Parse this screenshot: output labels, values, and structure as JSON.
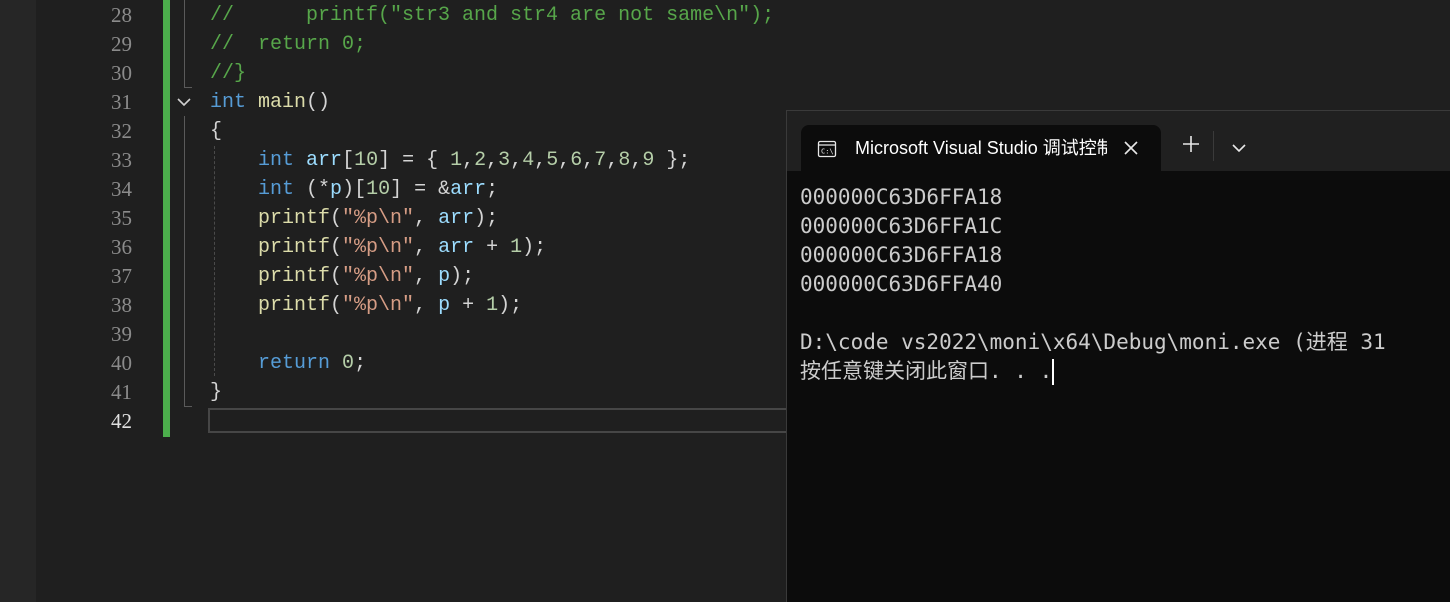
{
  "editor": {
    "line_numbers": [
      "28",
      "29",
      "30",
      "31",
      "32",
      "33",
      "34",
      "35",
      "36",
      "37",
      "38",
      "39",
      "40",
      "41",
      "42"
    ],
    "active_line": "42",
    "lines": [
      [
        {
          "t": "//      printf(\"str3 and str4 are not same\\n\");",
          "c": "cm"
        }
      ],
      [
        {
          "t": "//  return 0;",
          "c": "cm"
        }
      ],
      [
        {
          "t": "//}",
          "c": "cm"
        }
      ],
      [
        {
          "t": "int",
          "c": "kw"
        },
        {
          "t": " ",
          "c": "pl"
        },
        {
          "t": "main",
          "c": "fn"
        },
        {
          "t": "()",
          "c": "pl"
        }
      ],
      [
        {
          "t": "{",
          "c": "pl"
        }
      ],
      [
        {
          "t": "    ",
          "c": "pl"
        },
        {
          "t": "int",
          "c": "kw"
        },
        {
          "t": " ",
          "c": "pl"
        },
        {
          "t": "arr",
          "c": "id"
        },
        {
          "t": "[",
          "c": "pl"
        },
        {
          "t": "10",
          "c": "nm"
        },
        {
          "t": "] = { ",
          "c": "pl"
        },
        {
          "t": "1",
          "c": "nm"
        },
        {
          "t": ",",
          "c": "pl"
        },
        {
          "t": "2",
          "c": "nm"
        },
        {
          "t": ",",
          "c": "pl"
        },
        {
          "t": "3",
          "c": "nm"
        },
        {
          "t": ",",
          "c": "pl"
        },
        {
          "t": "4",
          "c": "nm"
        },
        {
          "t": ",",
          "c": "pl"
        },
        {
          "t": "5",
          "c": "nm"
        },
        {
          "t": ",",
          "c": "pl"
        },
        {
          "t": "6",
          "c": "nm"
        },
        {
          "t": ",",
          "c": "pl"
        },
        {
          "t": "7",
          "c": "nm"
        },
        {
          "t": ",",
          "c": "pl"
        },
        {
          "t": "8",
          "c": "nm"
        },
        {
          "t": ",",
          "c": "pl"
        },
        {
          "t": "9",
          "c": "nm"
        },
        {
          "t": " };",
          "c": "pl"
        }
      ],
      [
        {
          "t": "    ",
          "c": "pl"
        },
        {
          "t": "int",
          "c": "kw"
        },
        {
          "t": " (*",
          "c": "pl"
        },
        {
          "t": "p",
          "c": "id"
        },
        {
          "t": ")[",
          "c": "pl"
        },
        {
          "t": "10",
          "c": "nm"
        },
        {
          "t": "] = &",
          "c": "pl"
        },
        {
          "t": "arr",
          "c": "id"
        },
        {
          "t": ";",
          "c": "pl"
        }
      ],
      [
        {
          "t": "    ",
          "c": "pl"
        },
        {
          "t": "printf",
          "c": "fn"
        },
        {
          "t": "(",
          "c": "pl"
        },
        {
          "t": "\"%p\\n\"",
          "c": "st"
        },
        {
          "t": ", ",
          "c": "pl"
        },
        {
          "t": "arr",
          "c": "id"
        },
        {
          "t": ");",
          "c": "pl"
        }
      ],
      [
        {
          "t": "    ",
          "c": "pl"
        },
        {
          "t": "printf",
          "c": "fn"
        },
        {
          "t": "(",
          "c": "pl"
        },
        {
          "t": "\"%p\\n\"",
          "c": "st"
        },
        {
          "t": ", ",
          "c": "pl"
        },
        {
          "t": "arr",
          "c": "id"
        },
        {
          "t": " + ",
          "c": "pl"
        },
        {
          "t": "1",
          "c": "nm"
        },
        {
          "t": ");",
          "c": "pl"
        }
      ],
      [
        {
          "t": "    ",
          "c": "pl"
        },
        {
          "t": "printf",
          "c": "fn"
        },
        {
          "t": "(",
          "c": "pl"
        },
        {
          "t": "\"%p\\n\"",
          "c": "st"
        },
        {
          "t": ", ",
          "c": "pl"
        },
        {
          "t": "p",
          "c": "id"
        },
        {
          "t": ");",
          "c": "pl"
        }
      ],
      [
        {
          "t": "    ",
          "c": "pl"
        },
        {
          "t": "printf",
          "c": "fn"
        },
        {
          "t": "(",
          "c": "pl"
        },
        {
          "t": "\"%p\\n\"",
          "c": "st"
        },
        {
          "t": ", ",
          "c": "pl"
        },
        {
          "t": "p",
          "c": "id"
        },
        {
          "t": " + ",
          "c": "pl"
        },
        {
          "t": "1",
          "c": "nm"
        },
        {
          "t": ");",
          "c": "pl"
        }
      ],
      [
        {
          "t": "",
          "c": "pl"
        }
      ],
      [
        {
          "t": "    ",
          "c": "pl"
        },
        {
          "t": "return",
          "c": "kw"
        },
        {
          "t": " ",
          "c": "pl"
        },
        {
          "t": "0",
          "c": "nm"
        },
        {
          "t": ";",
          "c": "pl"
        }
      ],
      [
        {
          "t": "}",
          "c": "pl"
        }
      ],
      [
        {
          "t": "",
          "c": "pl"
        }
      ]
    ],
    "colors": {
      "comment": "#57a64a",
      "keyword": "#569cd6",
      "function": "#dcdcaa",
      "identifier": "#9cdcfe",
      "number": "#b5cea8",
      "string": "#d69d85",
      "change_bar": "#4cae4c"
    }
  },
  "console": {
    "tab_title": "Microsoft Visual Studio 调试控制台",
    "tab_icon": "console-icon",
    "close_icon": "close-icon",
    "new_tab_icon": "plus-icon",
    "dropdown_icon": "chevron-down-icon",
    "output_lines": [
      "000000C63D6FFA18",
      "000000C63D6FFA1C",
      "000000C63D6FFA18",
      "000000C63D6FFA40",
      "",
      "D:\\code vs2022\\moni\\x64\\Debug\\moni.exe (进程 31",
      "按任意键关闭此窗口. . ."
    ]
  }
}
